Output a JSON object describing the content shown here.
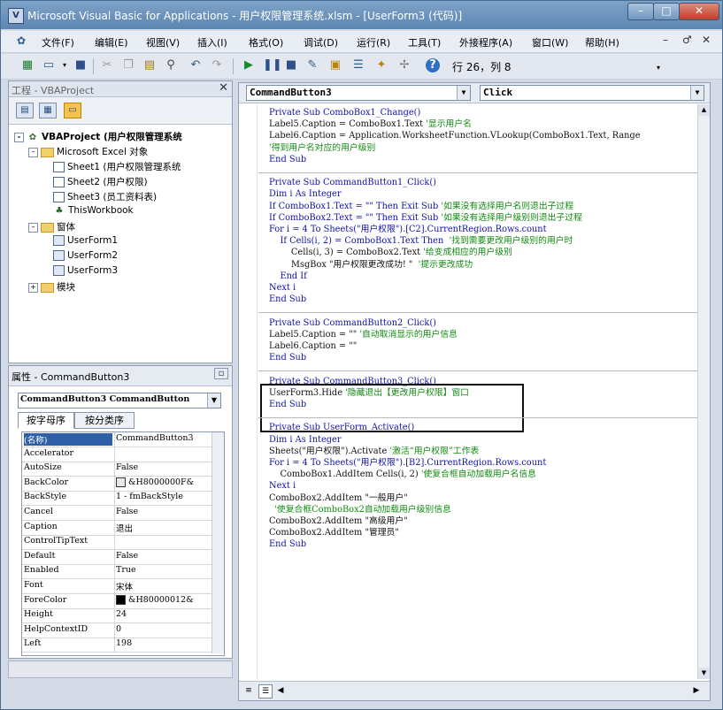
{
  "window": {
    "title": "Microsoft Visual Basic for Applications - 用户权限管理系统.xlsm - [UserForm3 (代码)]"
  },
  "menu": {
    "items": [
      "文件(F)",
      "编辑(E)",
      "视图(V)",
      "插入(I)",
      "格式(O)",
      "调试(D)",
      "运行(R)",
      "工具(T)",
      "外接程序(A)",
      "窗口(W)",
      "帮助(H)"
    ],
    "window_controls": [
      "–",
      "♂",
      "✕"
    ]
  },
  "toolbar": {
    "position": "行 26，列 8"
  },
  "project": {
    "title": "工程 - VBAProject",
    "root": "VBAProject (用户权限管理系统",
    "excel_objects": "Microsoft Excel 对象",
    "sheets": [
      "Sheet1 (用户权限管理系统",
      "Sheet2 (用户权限)",
      "Sheet3 (员工资料表)",
      "ThisWorkbook"
    ],
    "forms_folder": "窗体",
    "forms": [
      "UserForm1",
      "UserForm2",
      "UserForm3"
    ],
    "modules_folder": "模块"
  },
  "properties": {
    "title": "属性 - CommandButton3",
    "selector": "CommandButton3 CommandButton",
    "tabs": [
      "按字母序",
      "按分类序"
    ],
    "rows": [
      {
        "k": "(名称)",
        "v": "CommandButton3"
      },
      {
        "k": "Accelerator",
        "v": ""
      },
      {
        "k": "AutoSize",
        "v": "False"
      },
      {
        "k": "BackColor",
        "v": "&H8000000F&"
      },
      {
        "k": "BackStyle",
        "v": "1 - fmBackStyle"
      },
      {
        "k": "Cancel",
        "v": "False"
      },
      {
        "k": "Caption",
        "v": "退出"
      },
      {
        "k": "ControlTipText",
        "v": ""
      },
      {
        "k": "Default",
        "v": "False"
      },
      {
        "k": "Enabled",
        "v": "True"
      },
      {
        "k": "Font",
        "v": "宋体"
      },
      {
        "k": "ForeColor",
        "v": "&H80000012&"
      },
      {
        "k": "Height",
        "v": "24"
      },
      {
        "k": "HelpContextID",
        "v": "0"
      },
      {
        "k": "Left",
        "v": "198"
      }
    ],
    "backcolor_swatch": "#e8e8e8",
    "forecolor_swatch": "#000000"
  },
  "code": {
    "object": "CommandButton3",
    "procedure": "Click",
    "lines": [
      {
        "t": "Private Sub ComboBox1_Change()",
        "c": ""
      },
      {
        "t": "Label5.Caption = ComboBox1.Text ",
        "c": "'显示用户名"
      },
      {
        "t": "Label6.Caption = Application.WorksheetFunction.VLookup(ComboBox1.Text, Range",
        "c": ""
      },
      {
        "t": "",
        "c": "'得到用户名对应的用户级别"
      },
      {
        "t": "End Sub",
        "c": ""
      },
      {
        "t": "",
        "c": ""
      },
      {
        "t": "Private Sub CommandButton1_Click()",
        "c": ""
      },
      {
        "t": "Dim i As Integer",
        "c": ""
      },
      {
        "t": "If ComboBox1.Text = \"\" Then Exit Sub ",
        "c": "'如果没有选择用户名则退出子过程"
      },
      {
        "t": "If ComboBox2.Text = \"\" Then Exit Sub ",
        "c": "'如果没有选择用户级别则退出子过程"
      },
      {
        "t": "For i = 4 To Sheets(\"用户权限\").[C2].CurrentRegion.Rows.count",
        "c": ""
      },
      {
        "t": "    If Cells(i, 2) = ComboBox1.Text Then  ",
        "c": "'找到需要更改用户级别的用户时"
      },
      {
        "t": "        Cells(i, 3) = ComboBox2.Text ",
        "c": "'给变成相应的用户级别"
      },
      {
        "t": "        MsgBox \"用户权限更改成功! \"  ",
        "c": "'提示更改成功"
      },
      {
        "t": "    End If",
        "c": ""
      },
      {
        "t": "Next i",
        "c": ""
      },
      {
        "t": "End Sub",
        "c": ""
      },
      {
        "t": "",
        "c": ""
      },
      {
        "t": "Private Sub CommandButton2_Click()",
        "c": ""
      },
      {
        "t": "Label5.Caption = \"\" ",
        "c": "'自动取消显示的用户信息"
      },
      {
        "t": "Label6.Caption = \"\"",
        "c": ""
      },
      {
        "t": "End Sub",
        "c": ""
      },
      {
        "t": "",
        "c": ""
      },
      {
        "t": "Private Sub CommandButton3_Click()",
        "c": ""
      },
      {
        "t": "UserForm3.Hide ",
        "c": "'隐藏退出【更改用户权限】窗口"
      },
      {
        "t": "End Sub",
        "c": ""
      },
      {
        "t": "",
        "c": ""
      },
      {
        "t": "Private Sub UserForm_Activate()",
        "c": ""
      },
      {
        "t": "Dim i As Integer",
        "c": ""
      },
      {
        "t": "Sheets(\"用户权限\").Activate ",
        "c": "'激活“用户权限”工作表"
      },
      {
        "t": "For i = 4 To Sheets(\"用户权限\").[B2].CurrentRegion.Rows.count",
        "c": ""
      },
      {
        "t": "    ComboBox1.AddItem Cells(i, 2) ",
        "c": "'使复合框自动加载用户名信息"
      },
      {
        "t": "Next i",
        "c": ""
      },
      {
        "t": "ComboBox2.AddItem \"一般用户\"",
        "c": ""
      },
      {
        "t": "  ",
        "c": "'使复合框ComboBox2自动加载用户级别信息"
      },
      {
        "t": "ComboBox2.AddItem \"高级用户\"",
        "c": ""
      },
      {
        "t": "ComboBox2.AddItem \"管理员\"",
        "c": ""
      },
      {
        "t": "End Sub",
        "c": ""
      }
    ]
  }
}
